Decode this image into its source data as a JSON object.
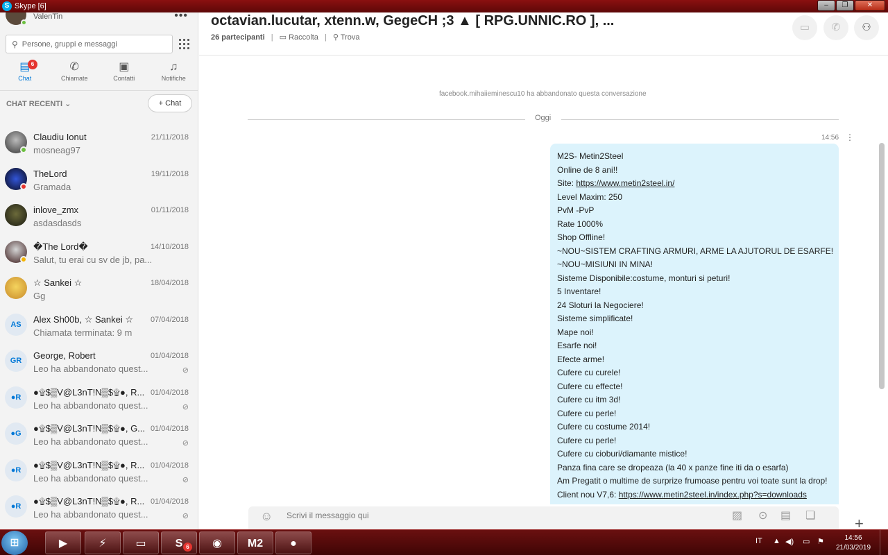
{
  "window": {
    "title": "Skype [6]"
  },
  "sidebar": {
    "profile_name": "ValenTin",
    "search_placeholder": "Persone, gruppi e messaggi",
    "tabs": [
      {
        "label": "Chat",
        "badge": "6",
        "active": true
      },
      {
        "label": "Chiamate"
      },
      {
        "label": "Contatti"
      },
      {
        "label": "Notifiche"
      }
    ],
    "recent_header": "CHAT RECENTI",
    "new_chat_label": "Chat",
    "chats": [
      {
        "name": "Claudiu Ionut",
        "date": "21/11/2018",
        "message": "mosneag97",
        "status": "#6bbf3f",
        "initials": ""
      },
      {
        "name": "TheLord",
        "date": "19/11/2018",
        "message": "Gramada",
        "status": "#e5342f",
        "initials": ""
      },
      {
        "name": "inlove_zmx",
        "date": "01/11/2018",
        "message": "asdasdasds",
        "status": "",
        "initials": ""
      },
      {
        "name": "�The Lord�",
        "date": "14/10/2018",
        "message": "Salut, tu erai cu sv de jb, pa...",
        "status": "#f4b400",
        "initials": ""
      },
      {
        "name": "☆ Sankei ☆",
        "date": "18/04/2018",
        "message": "Gg",
        "status": "",
        "initials": ""
      },
      {
        "name": "Alex Sh00b, ☆ Sankei ☆",
        "date": "07/04/2018",
        "message": "Chiamata terminata: 9 m",
        "status": "",
        "initials": "AS"
      },
      {
        "name": "George, Robert",
        "date": "01/04/2018",
        "message": "Leo ha abbandonato quest...",
        "status": "",
        "initials": "GR"
      },
      {
        "name": "●۩$▒V@L3nT!N▒$۩●, R...",
        "date": "01/04/2018",
        "message": "Leo ha abbandonato quest...",
        "status": "",
        "initials": "●R"
      },
      {
        "name": "●۩$▒V@L3nT!N▒$۩●, G...",
        "date": "01/04/2018",
        "message": "Leo ha abbandonato quest...",
        "status": "",
        "initials": "●G"
      },
      {
        "name": "●۩$▒V@L3nT!N▒$۩●, R...",
        "date": "01/04/2018",
        "message": "Leo ha abbandonato quest...",
        "status": "",
        "initials": "●R"
      },
      {
        "name": "●۩$▒V@L3nT!N▒$۩●, R...",
        "date": "01/04/2018",
        "message": "Leo ha abbandonato quest...",
        "status": "",
        "initials": "●R"
      }
    ]
  },
  "conversation": {
    "title": "octavian.lucutar, xtenn.w, GegeCH ;3 ▲ [ RPG.UNNIC.RO ], ...",
    "participants": "26 partecipanti",
    "gallery_label": "Raccolta",
    "find_label": "Trova",
    "system_message": "facebook.mihaiieminescu10 ha abbandonato questa conversazione",
    "day_label": "Oggi",
    "time": "14:56",
    "message_lines": [
      "M2S- Metin2Steel",
      "Online de 8 ani!!",
      "Site: ",
      "Level Maxim: 250",
      "PvM -PvP",
      "Rate 1000%",
      "Shop Offline!",
      "~NOU~SISTEM CRAFTING ARMURI, ARME LA AJUTORUL DE ESARFE!",
      "~NOU~MISIUNI IN MINA!",
      "Sisteme Disponibile:costume, monturi si peturi!",
      "5 Inventare!",
      "24 Sloturi la Negociere!",
      "Sisteme simplificate!",
      "Mape noi!",
      "Esarfe noi!",
      "Efecte arme!",
      "Cufere cu curele!",
      "Cufere cu effecte!",
      "Cufere cu itm 3d!",
      "Cufere cu perle!",
      "Cufere cu costume 2014!",
      "Cufere cu perle!",
      "Cufere cu cioburi/diamante mistice!",
      "Panza fina care se dropeaza (la 40 x panze fine iti da o esarfa)",
      "Am Pregatit o multime de surprize frumoase pentru voi toate sunt la drop!",
      "Client nou V7,6: "
    ],
    "site_link": "https://www.metin2steel.in/",
    "client_link": "https://www.metin2steel.in/index.php?s=downloads",
    "composer_placeholder": "Scrivi il messaggio qui"
  },
  "taskbar": {
    "skype_badge": "6",
    "app_label": "M2",
    "language": "IT",
    "time": "14:56",
    "date": "21/03/2019"
  },
  "colors": {
    "accent": "#0078d7",
    "bubble": "#dcf3fc",
    "titlebar": "#7a0e0e",
    "badge": "#e5342f"
  }
}
